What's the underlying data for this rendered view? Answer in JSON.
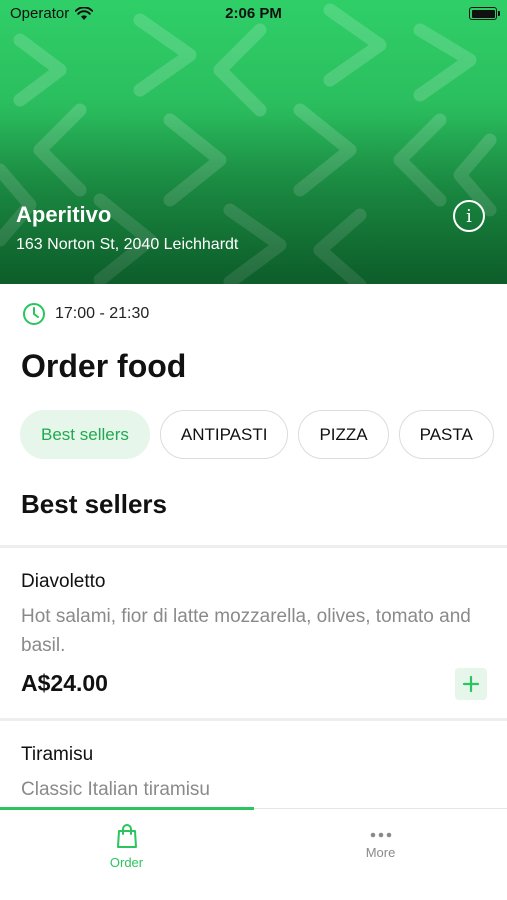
{
  "status_bar": {
    "carrier": "Operator",
    "time": "2:06 PM"
  },
  "venue": {
    "name": "Aperitivo",
    "address": "163 Norton St, 2040 Leichhardt"
  },
  "hours": "17:00 - 21:30",
  "page_title": "Order food",
  "categories": [
    {
      "label": "Best sellers",
      "active": true
    },
    {
      "label": "ANTIPASTI",
      "active": false
    },
    {
      "label": "PIZZA",
      "active": false
    },
    {
      "label": "PASTA",
      "active": false
    }
  ],
  "section_title": "Best sellers",
  "items": [
    {
      "name": "Diavoletto",
      "description": "Hot salami, fior di latte mozzarella, olives, tomato and basil.",
      "price": "A$24.00"
    },
    {
      "name": "Tiramisu",
      "description": "Classic Italian tiramisu"
    }
  ],
  "tabs": [
    {
      "label": "Order",
      "icon": "shopping-bag-icon",
      "active": true
    },
    {
      "label": "More",
      "icon": "more-dots-icon",
      "active": false
    }
  ],
  "colors": {
    "brand": "#2bc45e",
    "chip_active_bg": "#e6f6ea",
    "muted_text": "#8a8a8a"
  }
}
